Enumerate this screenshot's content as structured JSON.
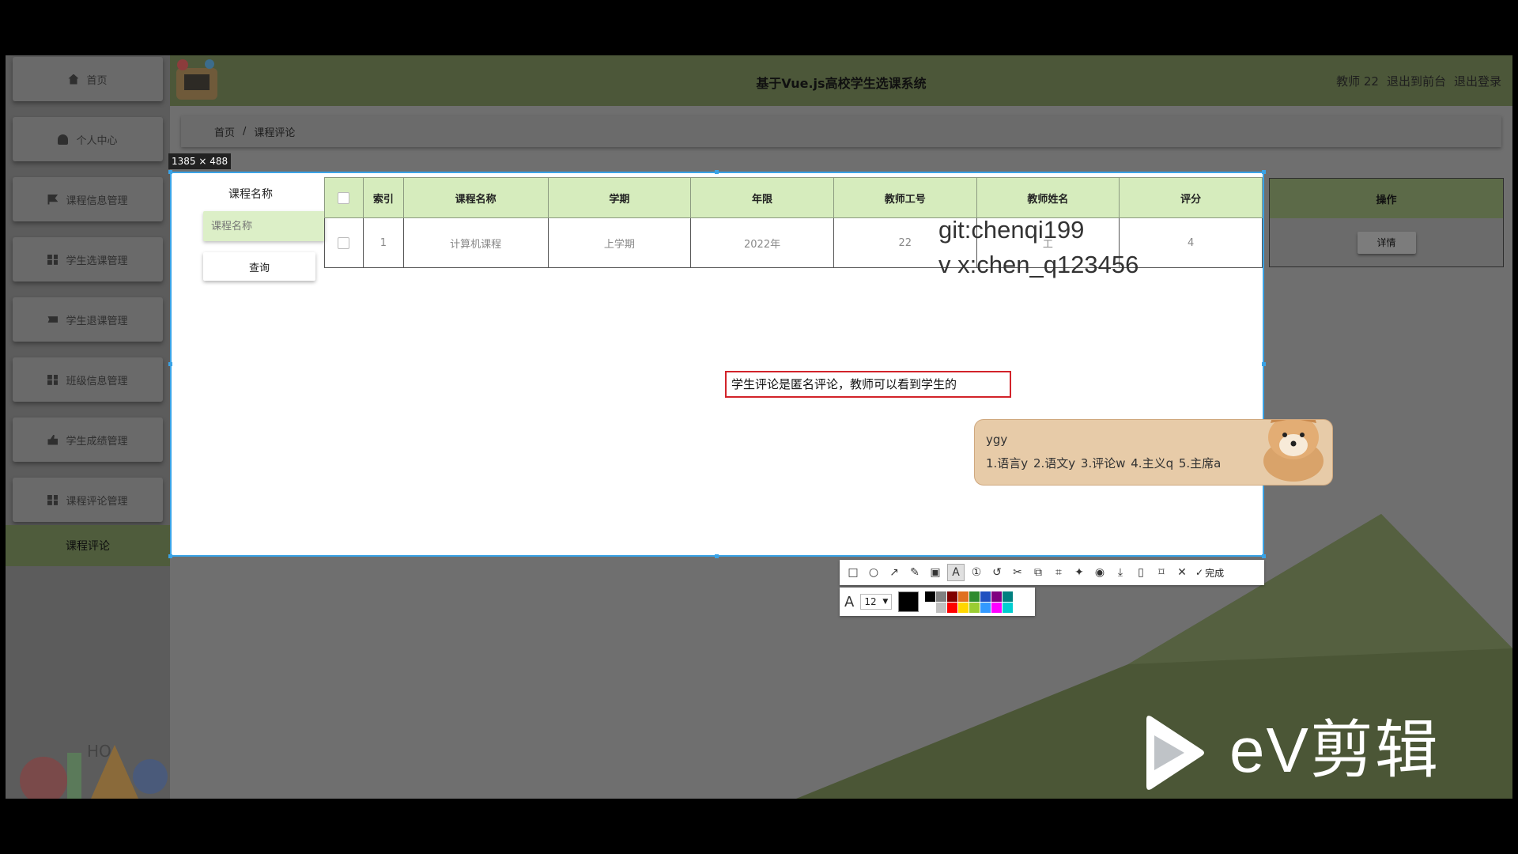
{
  "site_title": "基于Vue.js高校学生选课系统",
  "user": {
    "name": "教师 22",
    "to_front": "退出到前台",
    "logout": "退出登录"
  },
  "sidebar": {
    "items": [
      {
        "label": "首页",
        "icon": "home-icon"
      },
      {
        "label": "个人中心",
        "icon": "user-icon"
      },
      {
        "label": "课程信息管理",
        "icon": "flag-icon"
      },
      {
        "label": "学生选课管理",
        "icon": "grid-icon"
      },
      {
        "label": "学生退课管理",
        "icon": "ticket-icon"
      },
      {
        "label": "班级信息管理",
        "icon": "grid-icon"
      },
      {
        "label": "学生成绩管理",
        "icon": "thumb-icon"
      },
      {
        "label": "课程评论管理",
        "icon": "grid-icon"
      }
    ],
    "active_sub": "课程评论"
  },
  "breadcrumb": {
    "home": "首页",
    "sep": "/",
    "current": "课程评论"
  },
  "capture": {
    "size_label": "1385 × 488"
  },
  "search": {
    "label": "课程名称",
    "placeholder": "课程名称",
    "button": "查询"
  },
  "table": {
    "headers": [
      "索引",
      "课程名称",
      "学期",
      "年限",
      "教师工号",
      "教师姓名",
      "评分",
      "操作"
    ],
    "rows": [
      {
        "index": "1",
        "course": "计算机课程",
        "term": "上学期",
        "year": "2022年",
        "teacher_id": "22",
        "teacher_name": "工",
        "score": "4",
        "action": "详情"
      }
    ]
  },
  "watermark": {
    "line1": "git:chenqi199",
    "line2": "v x:chen_q123456"
  },
  "annotation_text": "学生评论是匿名评论，教师可以看到学生的",
  "ime": {
    "input": "ygy",
    "candidates": "1.语言y  2.语文y  3.评论w  4.主义q  5.主席a"
  },
  "toolbar": {
    "done": "完成",
    "font_size": "12"
  },
  "palette": [
    "#000000",
    "#808080",
    "#800000",
    "#e07020",
    "#2e8b2e",
    "#2050c0",
    "#800080",
    "#008080",
    "#ffffff",
    "#c0c0c0",
    "#ff0000",
    "#ffd700",
    "#9acd32",
    "#3399ff",
    "#ff00ff",
    "#00ced1"
  ],
  "ev_brand": "eV剪辑"
}
